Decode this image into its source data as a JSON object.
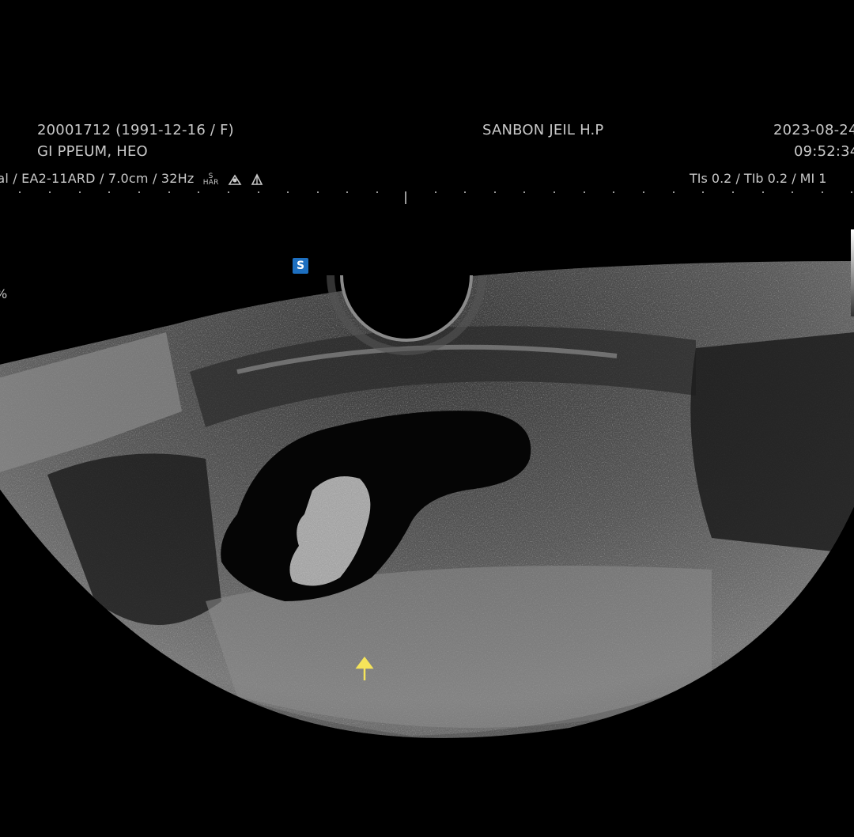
{
  "header": {
    "patient_id_line": "20001712 (1991-12-16 / F)",
    "patient_name": "GI PPEUM, HEO",
    "hospital": "SANBON JEIL H.P",
    "date": "2023-08-24",
    "time": "09:52:34"
  },
  "scan_params": {
    "probe_line": "nal / EA2-11ARD / 7.0cm / 32Hz",
    "har_top": "S",
    "har_bottom": "HAR",
    "thermal_line": "TIs  0.2 / TIb  0.2 / MI   1"
  },
  "image": {
    "focus_marker": "S",
    "side_label": "%",
    "arrow_color": "#f5e45a",
    "marker_color": "#1d6fc0"
  }
}
